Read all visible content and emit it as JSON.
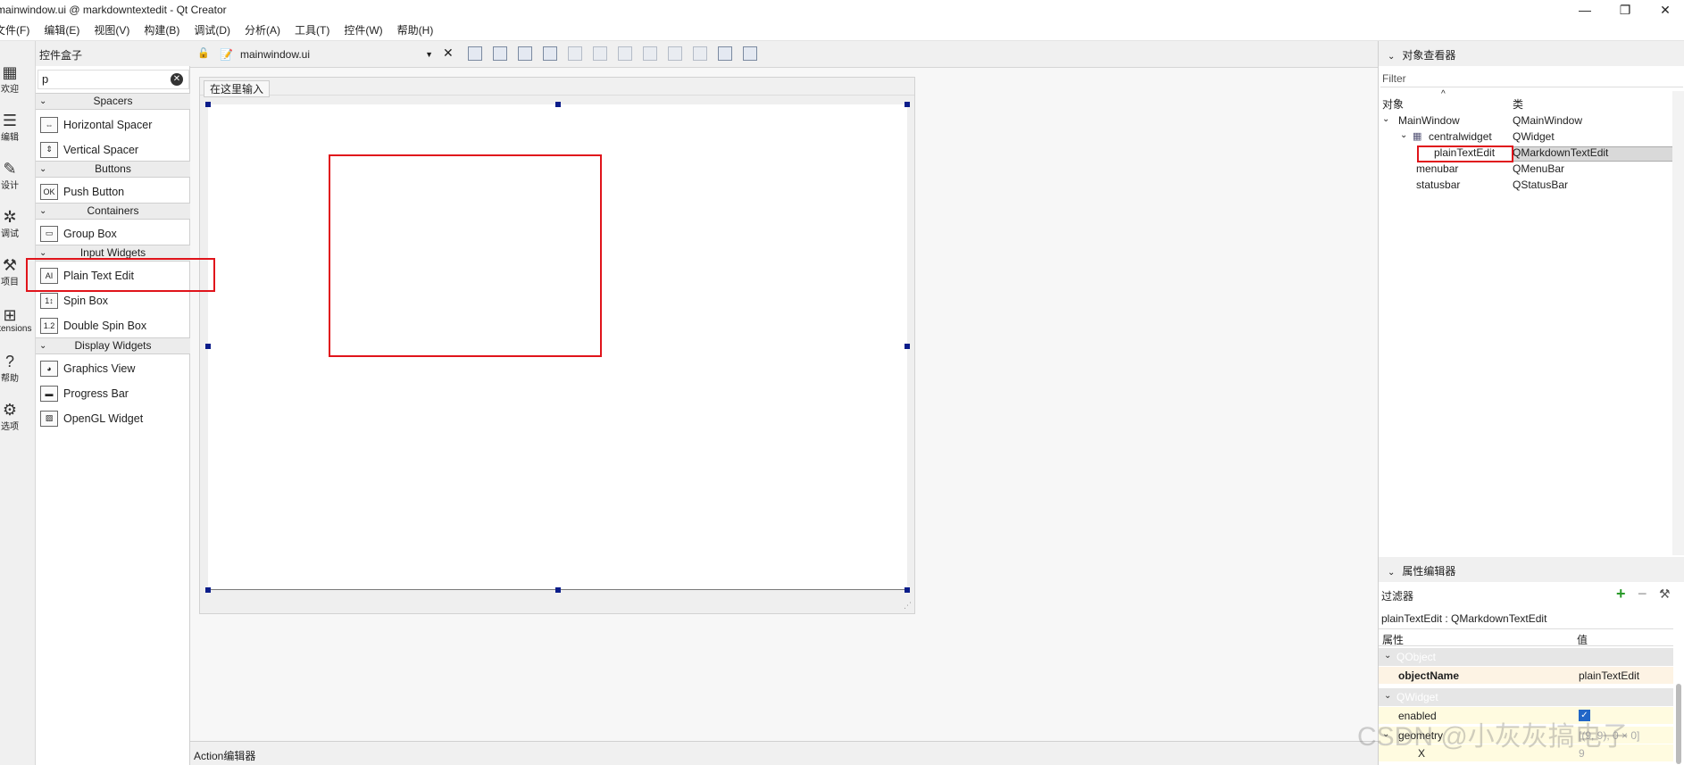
{
  "window": {
    "title": "mainwindow.ui @ markdowntextedit - Qt Creator",
    "controls": [
      "—",
      "❐",
      "✕"
    ]
  },
  "menubar": [
    "文件(F)",
    "编辑(E)",
    "视图(V)",
    "构建(B)",
    "调试(D)",
    "分析(A)",
    "工具(T)",
    "控件(W)",
    "帮助(H)"
  ],
  "modes": [
    {
      "label": "欢迎",
      "icon": "grid-icon"
    },
    {
      "label": "编辑",
      "icon": "edit-icon"
    },
    {
      "label": "设计",
      "icon": "pen-icon"
    },
    {
      "label": "调试",
      "icon": "bug-icon"
    },
    {
      "label": "项目",
      "icon": "wrench-icon"
    },
    {
      "label": "Extensions",
      "icon": "extensions-icon"
    },
    {
      "label": "帮助",
      "icon": "help-icon"
    },
    {
      "label": "选项",
      "icon": "gear-icon"
    }
  ],
  "widget_box": {
    "title": "控件盒子",
    "filter_value": "p",
    "categories": [
      {
        "name": "Spacers",
        "items": [
          "Horizontal Spacer",
          "Vertical Spacer"
        ]
      },
      {
        "name": "Buttons",
        "items": [
          "Push Button"
        ]
      },
      {
        "name": "Containers",
        "items": [
          "Group Box"
        ]
      },
      {
        "name": "Input Widgets",
        "items": [
          "Plain Text Edit",
          "Spin Box",
          "Double Spin Box"
        ]
      },
      {
        "name": "Display Widgets",
        "items": [
          "Graphics View",
          "Progress Bar",
          "OpenGL Widget"
        ]
      }
    ],
    "item_icons": {
      "Horizontal Spacer": "horizontal-spacer-icon",
      "Vertical Spacer": "vertical-spacer-icon",
      "Push Button": "push-button-icon",
      "Group Box": "group-box-icon",
      "Plain Text Edit": "plain-text-edit-icon",
      "Spin Box": "spin-box-icon",
      "Double Spin Box": "double-spin-box-icon",
      "Graphics View": "graphics-view-icon",
      "Progress Bar": "progress-bar-icon",
      "OpenGL Widget": "opengl-widget-icon"
    }
  },
  "editor": {
    "file_name": "mainwindow.ui",
    "form_menu_placeholder": "在这里输入",
    "action_editor_label": "Action编辑器"
  },
  "object_inspector": {
    "title": "对象查看器",
    "filter_placeholder": "Filter",
    "col_object": "对象",
    "col_class": "类",
    "rows": [
      {
        "object": "MainWindow",
        "class": "QMainWindow"
      },
      {
        "object": "centralwidget",
        "class": "QWidget"
      },
      {
        "object": "plainTextEdit",
        "class": "QMarkdownTextEdit"
      },
      {
        "object": "menubar",
        "class": "QMenuBar"
      },
      {
        "object": "statusbar",
        "class": "QStatusBar"
      }
    ]
  },
  "property_editor": {
    "title": "属性编辑器",
    "filter_label": "过滤器",
    "context": "plainTextEdit : QMarkdownTextEdit",
    "col_property": "属性",
    "col_value": "值",
    "sections": [
      "QObject",
      "QWidget"
    ],
    "props": [
      {
        "name": "objectName",
        "value": "plainTextEdit"
      },
      {
        "name": "enabled",
        "value": "✓"
      },
      {
        "name": "geometry",
        "value": "[(9, 9), 0 × 0]"
      },
      {
        "name": "X",
        "value": "9"
      }
    ]
  },
  "watermark": "CSDN @小灰灰搞电子",
  "colors": {
    "highlight": "#e0141b",
    "handle": "#0b1d8a"
  }
}
